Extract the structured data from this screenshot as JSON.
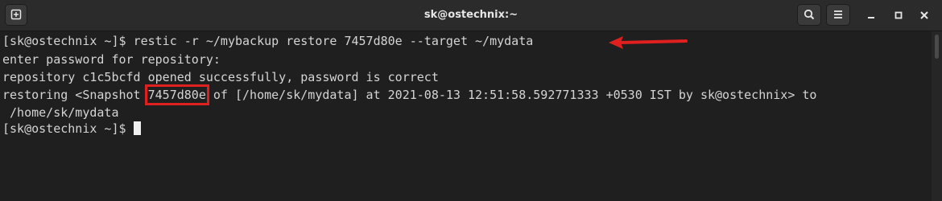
{
  "window": {
    "title": "sk@ostechnix:~"
  },
  "header": {
    "new_tab_icon": "new-tab-icon",
    "search_icon": "search-icon",
    "menu_icon": "hamburger-menu-icon",
    "minimize_icon": "minimize-icon",
    "maximize_icon": "maximize-icon",
    "close_icon": "close-icon"
  },
  "terminal": {
    "line1_prompt": "[sk@ostechnix ~]$ ",
    "line1_command": "restic -r ~/mybackup restore 7457d80e --target ~/mydata",
    "line2": "enter password for repository:",
    "line3": "repository c1c5bcfd opened successfully, password is correct",
    "line4_before": "restoring <Snapshot ",
    "line4_snapshot_id": "7457d80e",
    "line4_after": " of [/home/sk/mydata] at 2021-08-13 12:51:58.592771333 +0530 IST by sk@ostechnix> to",
    "line5": " /home/sk/mydata",
    "line6_prompt": "[sk@ostechnix ~]$ "
  },
  "annotations": {
    "arrow_color": "#e01f1f",
    "highlight_color": "#e01f1f"
  }
}
